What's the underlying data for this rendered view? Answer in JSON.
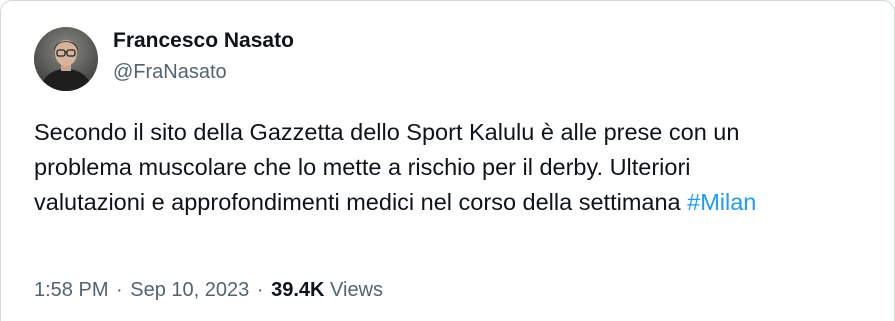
{
  "author": {
    "display_name": "Francesco Nasato",
    "handle": "@FraNasato"
  },
  "tweet": {
    "lines": [
      "Secondo il sito della Gazzetta dello Sport Kalulu è alle prese con un",
      "problema muscolare che lo mette a rischio per il derby. Ulteriori",
      "valutazioni e approfondimenti medici nel corso della settimana "
    ],
    "hashtag": "#Milan"
  },
  "meta": {
    "time": "1:58 PM",
    "separator": "·",
    "date": "Sep 10, 2023",
    "views_count": "39.4K",
    "views_label": "Views"
  },
  "colors": {
    "text": "#0f1419",
    "secondary": "#536471",
    "link": "#1d9bf0",
    "border": "#cfd9de"
  }
}
